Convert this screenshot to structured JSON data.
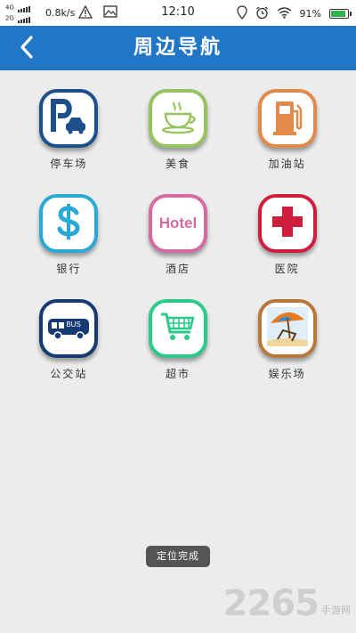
{
  "status_bar": {
    "net_4g": "4G",
    "net_2g": "2G",
    "speed": "0.8k/s",
    "time": "12:10",
    "battery_pct": "91%",
    "icons": [
      "warning-icon",
      "image-icon",
      "location-icon",
      "alarm-icon",
      "wifi-icon",
      "battery-icon"
    ]
  },
  "header": {
    "title": "周边导航",
    "back_icon": "chevron-left-icon"
  },
  "grid": {
    "items": [
      {
        "label": "停车场",
        "icon": "parking-icon",
        "color": "#1d4f8c"
      },
      {
        "label": "美食",
        "icon": "coffee-cup-icon",
        "color": "#98c45d"
      },
      {
        "label": "加油站",
        "icon": "gas-station-icon",
        "color": "#e28a4a"
      },
      {
        "label": "银行",
        "icon": "dollar-icon",
        "color": "#28a9d6"
      },
      {
        "label": "酒店",
        "icon": "hotel-icon",
        "icon_text": "Hotel",
        "color": "#d66aa2"
      },
      {
        "label": "医院",
        "icon": "medical-cross-icon",
        "color": "#cf1d3d"
      },
      {
        "label": "公交站",
        "icon": "bus-icon",
        "icon_text": "BUS",
        "color": "#163a72"
      },
      {
        "label": "超市",
        "icon": "shopping-cart-icon",
        "color": "#2bc98a"
      },
      {
        "label": "娱乐场",
        "icon": "beach-umbrella-icon",
        "color": "#b8783a"
      }
    ]
  },
  "toast": {
    "text": "定位完成"
  },
  "watermark": {
    "number": "2265",
    "text": "手游网"
  }
}
